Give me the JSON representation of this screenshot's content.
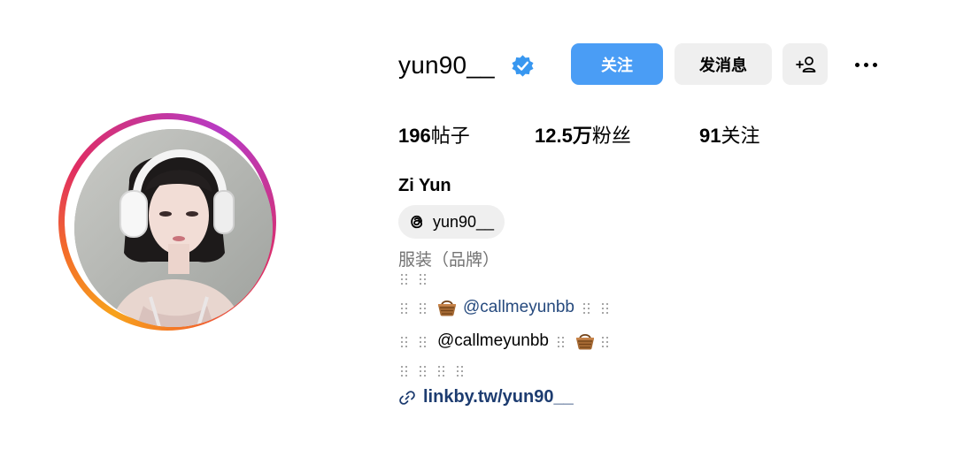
{
  "profile": {
    "username": "yun90__",
    "full_name": "Zi Yun",
    "verified": true,
    "category": "服装（品牌）"
  },
  "actions": {
    "follow_label": "关注",
    "message_label": "发消息",
    "add_icon": "person-add-icon",
    "more_icon": "more-options-icon"
  },
  "stats": {
    "posts_count": "196",
    "posts_label": "帖子",
    "followers_count": "12.5万",
    "followers_label": "粉丝",
    "following_count": "91",
    "following_label": "关注"
  },
  "threads": {
    "handle": "yun90__",
    "icon": "threads-icon"
  },
  "bio": {
    "line2_mention": "@callmeyunbb",
    "line3_mention": "@callmeyunbb",
    "decoration_icon": "braille-dots-icon",
    "emoji_icon": "basket-emoji-icon"
  },
  "link": {
    "url_text": "linkby.tw/yun90__",
    "icon": "link-icon"
  },
  "colors": {
    "accent_blue": "#4a9df5",
    "button_gray": "#efefef",
    "mention_blue": "#264a7e",
    "link_blue": "#1d3c70",
    "verified_blue": "#3897f0",
    "category_gray": "#737373"
  }
}
